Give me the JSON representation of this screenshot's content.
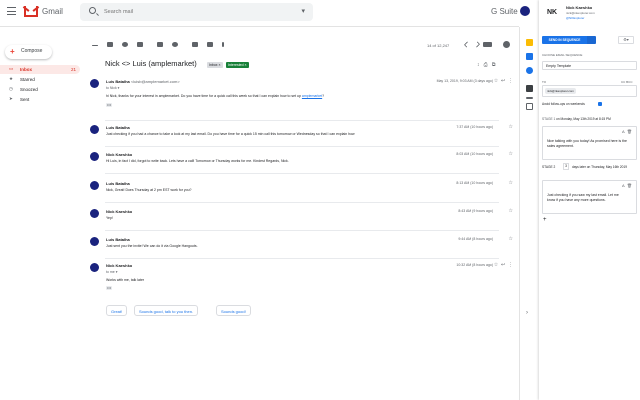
{
  "topbar": {
    "app_name": "Gmail",
    "search_placeholder": "Search mail",
    "gsuite": "G Suite"
  },
  "leftnav": {
    "compose": "Compose",
    "items": [
      {
        "icon": "inbox-icon",
        "label": "Inbox",
        "count": "21",
        "active": true
      },
      {
        "icon": "star-icon",
        "label": "Starred",
        "count": ""
      },
      {
        "icon": "clock-icon",
        "label": "Snoozed",
        "count": ""
      },
      {
        "icon": "send-icon",
        "label": "Sent",
        "count": ""
      }
    ]
  },
  "toolbar": {
    "pager": "14 of 12,247"
  },
  "thread": {
    "subject": "Nick <> Luis (amplemarket)",
    "labels": [
      "Inbox ×",
      "Interested ×"
    ],
    "messages": [
      {
        "from": "Luis Batalha",
        "email": "<luisb@amplemarket.com>",
        "date": "May 13, 2019, 9:03 AM (3 days ago)",
        "to": "to Nick ▾",
        "body": "hi Nick, thanks for your interest in amplemarket. Do you have time for a quick call this week so that I can explain how to set up ",
        "link": "amplemarket",
        "body_end": "?",
        "open": true
      },
      {
        "from": "Luis Batalha",
        "email": "",
        "date": "7:37 AM (10 hours ago)",
        "body": "Just checking if you had a chance to take a look at my last email. Do you have time for a quick 15 min call this tomorrow or Wednesday so that I can explain how"
      },
      {
        "from": "Nick Kaeshko",
        "email": "",
        "date": "8:03 AM (10 hours ago)",
        "body": "Hi Luis, in fact I did, forgot to write back. Lets have a call! Tomorrow or Thursday works for me. Kindest Regards, Nick."
      },
      {
        "from": "Luis Batalha",
        "email": "",
        "date": "8:13 AM (10 hours ago)",
        "body": "Nick, Great! Does Thursday at 2 pm EST work for you?"
      },
      {
        "from": "Nick Kaeshko",
        "email": "",
        "date": "8:43 AM (9 hours ago)",
        "body": "Yep!"
      },
      {
        "from": "Luis Batalha",
        "email": "",
        "date": "9:44 AM (8 hours ago)",
        "body": "Just sent you the invite! We can do it via Google Hangouts."
      },
      {
        "from": "Nick Kaeshko",
        "email": "",
        "date": "10:32 AM (8 hours ago)",
        "to": "to me ▾",
        "body": "Works with me, talk later",
        "open": true
      }
    ],
    "smart_replies": [
      "Great!",
      "Sounds good, talk to you then.",
      "Sounds good!"
    ]
  },
  "panel": {
    "initials": "NK",
    "name": "Nick Kaeshko",
    "email": "nick@nkexplorer.com",
    "handle": "@NKExplorer",
    "send_button": "SEND IN SEQUENCE",
    "choose_label": "CHOOSE EMAIL SEQUENCE",
    "sequence": "Empty Template",
    "to_label": "TO",
    "cc_bcc": "CC  BCC",
    "chip": "nick@nkexplorer.com",
    "avoid_weekends": "Avoid follow-ups on weekends",
    "stage1_label": "STAGE 1",
    "stage1_when": "on Monday, May 13th 2019 at 8:15 PM",
    "stage1_body": "Nice talking with you today! As promised here is the sales agreement.",
    "stage2_label": "STAGE 2",
    "stage2_days": "3",
    "stage2_when": "days later on Thursday, May 16th 2019",
    "stage2_body": "Just checking if you saw my last email. Let me know if you have any more questions."
  },
  "colors": {
    "accent": "#1a73e8",
    "gmail_red": "#d93025",
    "interested": "#188038"
  }
}
